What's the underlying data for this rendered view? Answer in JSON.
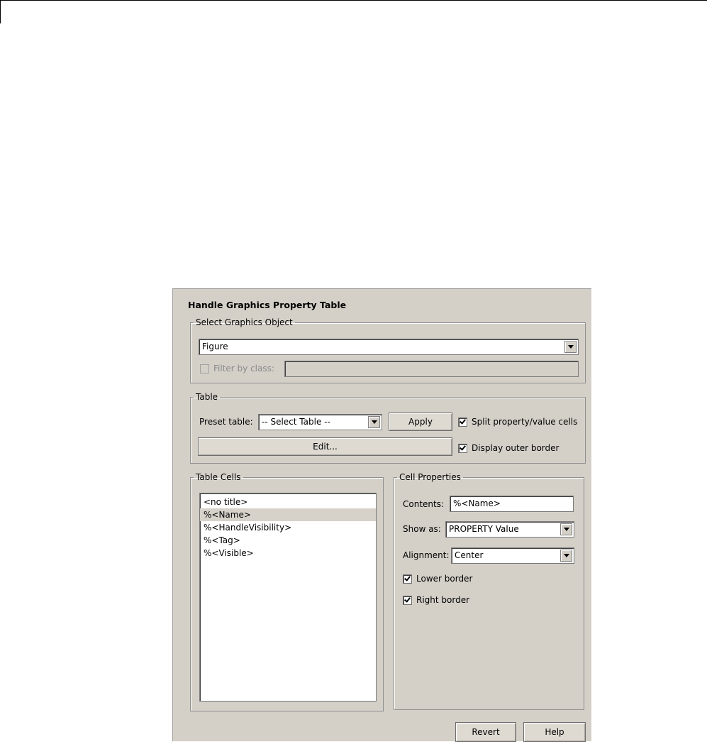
{
  "dialog": {
    "title": "Handle Graphics Property Table"
  },
  "select_group": {
    "legend": "Select Graphics Object",
    "object_value": "Figure",
    "filter_label": "Filter by class:",
    "filter_checked": false,
    "filter_value": ""
  },
  "table_group": {
    "legend": "Table",
    "preset_label": "Preset table:",
    "preset_value": "-- Select Table --",
    "apply_label": "Apply",
    "edit_label": "Edit...",
    "split_label": "Split property/value cells",
    "split_checked": true,
    "outer_border_label": "Display outer border",
    "outer_border_checked": true
  },
  "cells_group": {
    "legend": "Table Cells",
    "items": [
      "<no title>",
      "%<Name>",
      "%<HandleVisibility>",
      "%<Tag>",
      "%<Visible>"
    ],
    "selected_index": 1
  },
  "cell_props": {
    "legend": "Cell Properties",
    "contents_label": "Contents:",
    "contents_value": "%<Name>",
    "show_as_label": "Show as:",
    "show_as_value": "PROPERTY Value",
    "alignment_label": "Alignment:",
    "alignment_value": "Center",
    "lower_border_label": "Lower border",
    "lower_border_checked": true,
    "right_border_label": "Right border",
    "right_border_checked": true
  },
  "footer": {
    "revert_label": "Revert",
    "help_label": "Help"
  }
}
